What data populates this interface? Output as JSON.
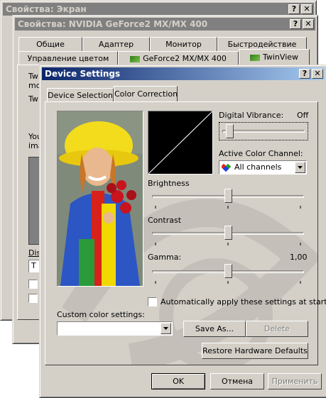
{
  "win1": {
    "title": "Свойства: Экран"
  },
  "win2": {
    "title": "Свойства: NVIDIA GeForce2 MX/MX 400",
    "tabs_row1": [
      "Общие",
      "Адаптер",
      "Монитор",
      "Быстродействие"
    ],
    "tabs_row2": [
      "Управление цветом",
      "GeForce2 MX/MX 400",
      "TwinView"
    ],
    "partial": {
      "tw1": "Tw",
      "mo": "mo",
      "tw2": "Tw",
      "you": "You",
      "ima": "ima",
      "dis": "Dis",
      "t": "T"
    }
  },
  "dialog": {
    "title": "Device Settings",
    "tabs": [
      "Device Selection",
      "Color Correction"
    ],
    "digital_vibrance_label": "Digital Vibrance:",
    "digital_vibrance_value": "Off",
    "digital_vibrance_level": 0.03,
    "active_channel_label": "Active Color Channel:",
    "active_channel_value": "All channels",
    "brightness_label": "Brightness",
    "brightness_level": 0.5,
    "contrast_label": "Contrast",
    "contrast_level": 0.5,
    "gamma_label": "Gamma:",
    "gamma_value": "1,00",
    "gamma_level": 0.5,
    "auto_apply_label": "Automatically apply these settings at startup",
    "auto_apply_checked": false,
    "custom_label": "Custom color settings:",
    "custom_value": "",
    "save_as": "Save As...",
    "delete": "Delete",
    "restore": "Restore Hardware Defaults"
  },
  "footer": {
    "ok": "OK",
    "cancel": "Отмена",
    "apply": "Применить"
  }
}
